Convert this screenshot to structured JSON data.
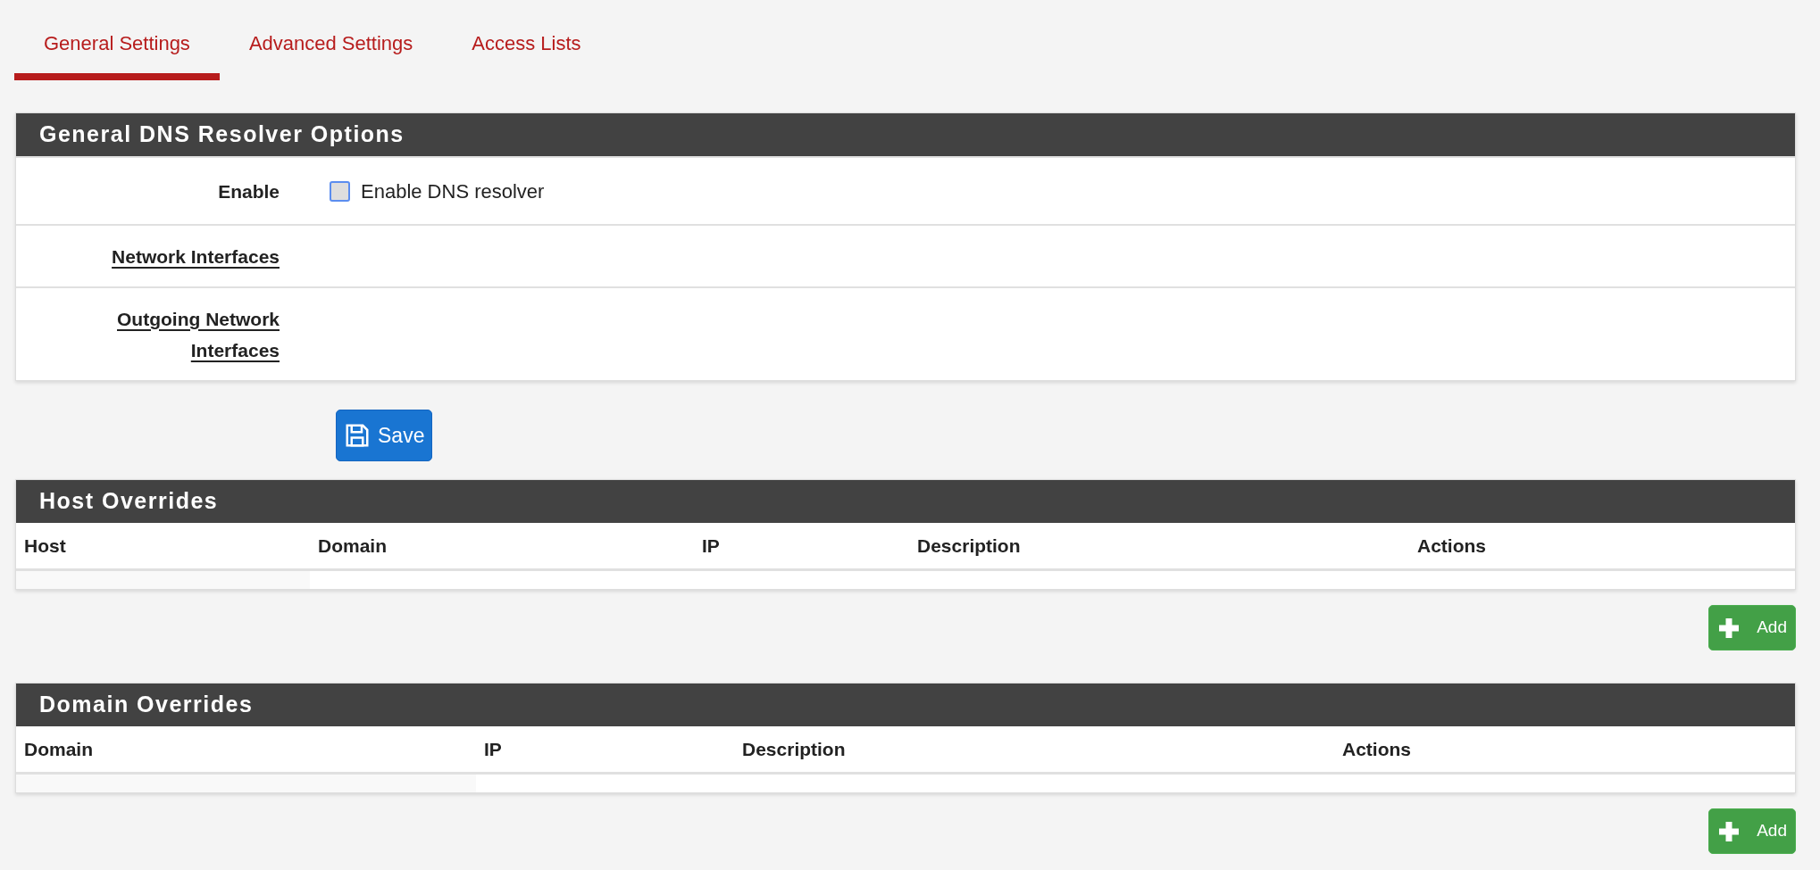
{
  "tabs": [
    {
      "label": "General Settings",
      "selected": true
    },
    {
      "label": "Advanced Settings",
      "selected": false
    },
    {
      "label": "Access Lists",
      "selected": false
    }
  ],
  "general_panel": {
    "title": "General DNS Resolver Options",
    "rows": [
      {
        "label": "Enable",
        "underlined": false,
        "kind": "checkbox",
        "checkbox": {
          "label": "Enable DNS resolver",
          "checked": false
        }
      },
      {
        "label": "Network Interfaces",
        "underlined": true,
        "kind": "empty"
      },
      {
        "label": "Outgoing Network Interfaces",
        "underlined": true,
        "kind": "empty"
      }
    ]
  },
  "save_button": {
    "label": "Save"
  },
  "tables": [
    {
      "title": "Host Overrides",
      "columns": [
        "Host",
        "Domain",
        "IP",
        "Description",
        "Actions"
      ],
      "add_button": {
        "label": "Add"
      }
    },
    {
      "title": "Domain Overrides",
      "columns": [
        "Domain",
        "IP",
        "Description",
        "Actions"
      ],
      "add_button": {
        "label": "Add"
      }
    }
  ]
}
